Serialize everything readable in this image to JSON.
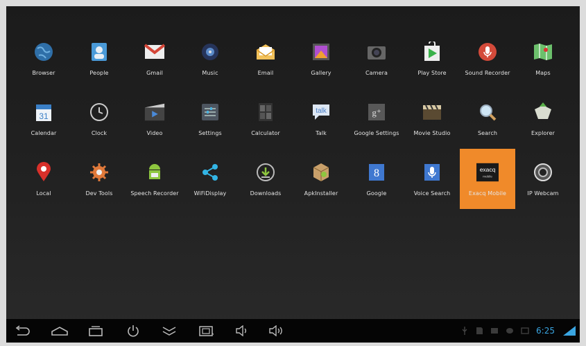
{
  "apps": [
    {
      "label": "Browser",
      "icon": "globe-icon"
    },
    {
      "label": "People",
      "icon": "people-icon"
    },
    {
      "label": "Gmail",
      "icon": "gmail-icon"
    },
    {
      "label": "Music",
      "icon": "music-icon"
    },
    {
      "label": "Email",
      "icon": "email-icon"
    },
    {
      "label": "Gallery",
      "icon": "gallery-icon"
    },
    {
      "label": "Camera",
      "icon": "camera-icon"
    },
    {
      "label": "Play Store",
      "icon": "play-store-icon"
    },
    {
      "label": "Sound Recorder",
      "icon": "microphone-icon"
    },
    {
      "label": "Maps",
      "icon": "maps-icon"
    },
    {
      "label": "Calendar",
      "icon": "calendar-icon"
    },
    {
      "label": "Clock",
      "icon": "clock-icon"
    },
    {
      "label": "Video",
      "icon": "video-icon"
    },
    {
      "label": "Settings",
      "icon": "settings-icon"
    },
    {
      "label": "Calculator",
      "icon": "calculator-icon"
    },
    {
      "label": "Talk",
      "icon": "talk-icon"
    },
    {
      "label": "Google Settings",
      "icon": "google-settings-icon"
    },
    {
      "label": "Movie Studio",
      "icon": "clapperboard-icon"
    },
    {
      "label": "Search",
      "icon": "search-icon"
    },
    {
      "label": "Explorer",
      "icon": "explorer-icon"
    },
    {
      "label": "Local",
      "icon": "map-pin-icon"
    },
    {
      "label": "Dev Tools",
      "icon": "dev-tools-gear-icon"
    },
    {
      "label": "Speech Recorder",
      "icon": "android-robot-icon"
    },
    {
      "label": "WiFiDisplay",
      "icon": "share-icon"
    },
    {
      "label": "Downloads",
      "icon": "download-icon"
    },
    {
      "label": "ApkInstaller",
      "icon": "package-icon"
    },
    {
      "label": "Google",
      "icon": "google-icon"
    },
    {
      "label": "Voice Search",
      "icon": "voice-search-icon"
    },
    {
      "label": "Exacq Mobile",
      "icon": "exacq-icon",
      "highlighted": true
    },
    {
      "label": "IP Webcam",
      "icon": "webcam-icon"
    }
  ],
  "exacq_logo": {
    "line1": "exacq",
    "line2": "mobile"
  },
  "google_settings_glyph": "g⁺",
  "calendar_day": "31",
  "talk_text": "talk",
  "navigation": [
    "back-icon",
    "home-icon",
    "recent-apps-icon",
    "power-icon",
    "collapse-icon",
    "screenshot-icon",
    "volume-down-icon",
    "volume-up-icon"
  ],
  "status_bar": {
    "time": "6:25",
    "accent_color": "#3aa6e2"
  },
  "colors": {
    "highlight": "#f08a2a",
    "background": "#1e1e1e"
  }
}
